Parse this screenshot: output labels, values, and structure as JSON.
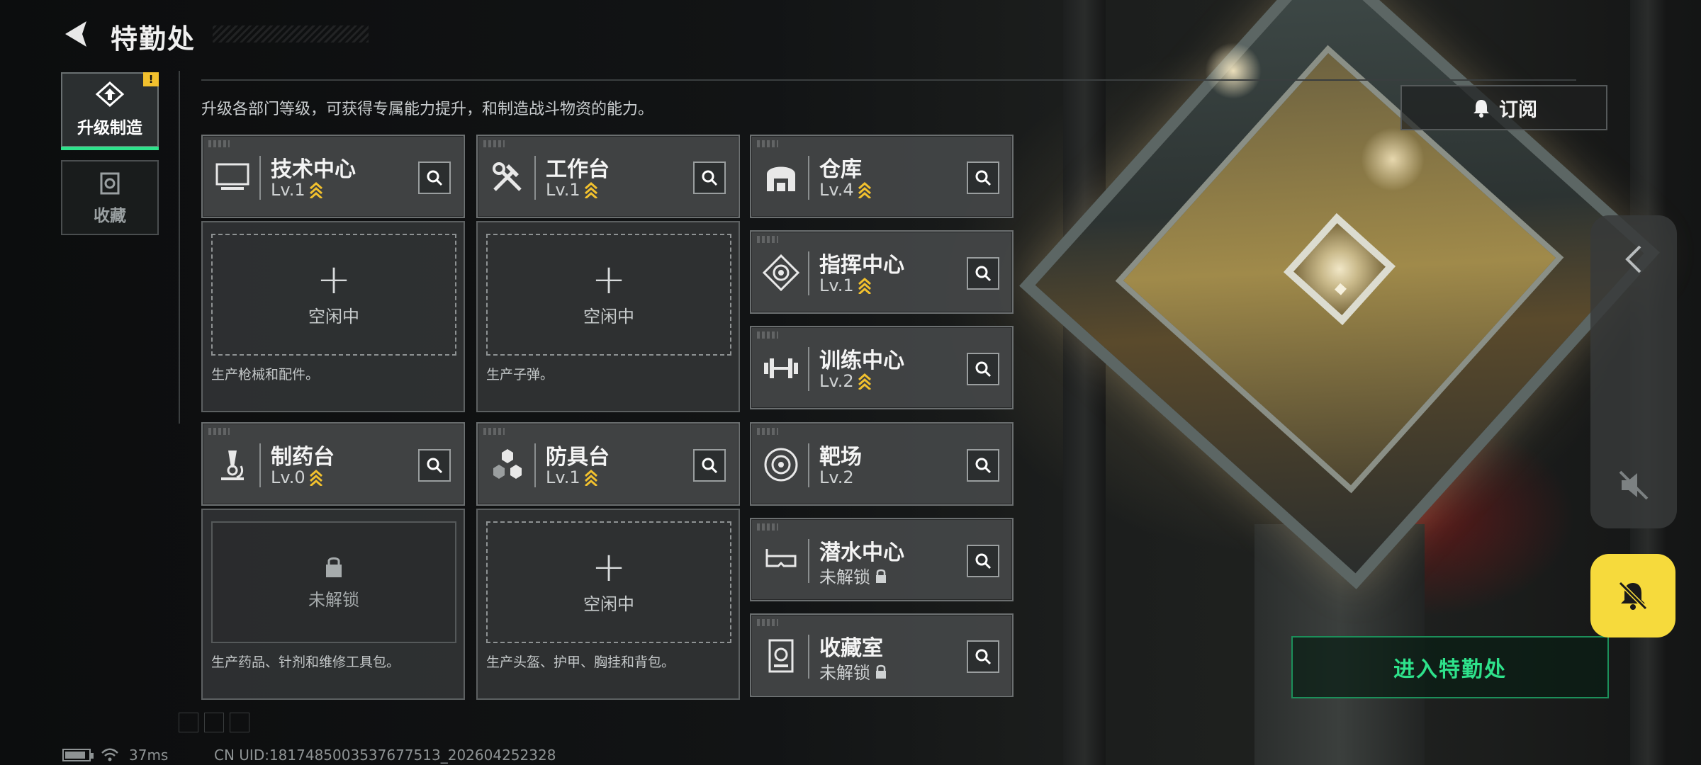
{
  "header": {
    "title": "特勤处"
  },
  "tabs": [
    {
      "label": "升级制造",
      "alert": "!",
      "icon": "upgrade-icon"
    },
    {
      "label": "收藏",
      "icon": "collection-icon"
    }
  ],
  "description": "升级各部门等级，可获得专属能力提升，和制造战斗物资的能力。",
  "subscribe_label": "订阅",
  "columns": {
    "left": {
      "top_card": {
        "name": "技术中心",
        "level": "Lv.1",
        "icon": "computer-icon"
      },
      "top_panel": {
        "slot_text": "空闲中",
        "desc": "生产枪械和配件。"
      },
      "bottom_card": {
        "name": "制药台",
        "level": "Lv.0",
        "icon": "microscope-icon"
      },
      "bottom_panel": {
        "slot_text": "未解锁",
        "desc": "生产药品、针剂和维修工具包。"
      }
    },
    "middle": {
      "top_card": {
        "name": "工作台",
        "level": "Lv.1",
        "icon": "tools-icon"
      },
      "top_panel": {
        "slot_text": "空闲中",
        "desc": "生产子弹。"
      },
      "bottom_card": {
        "name": "防具台",
        "level": "Lv.1",
        "icon": "armor-hex-icon"
      },
      "bottom_panel": {
        "slot_text": "空闲中",
        "desc": "生产头盔、护甲、胸挂和背包。"
      }
    },
    "right": [
      {
        "name": "仓库",
        "level": "Lv.4",
        "icon": "warehouse-icon"
      },
      {
        "name": "指挥中心",
        "level": "Lv.1",
        "icon": "command-icon"
      },
      {
        "name": "训练中心",
        "level": "Lv.2",
        "icon": "dumbbell-icon"
      },
      {
        "name": "靶场",
        "level": "Lv.2",
        "icon": "target-icon"
      },
      {
        "name": "潜水中心",
        "level": "未解锁",
        "icon": "diving-mask-icon"
      },
      {
        "name": "收藏室",
        "level": "未解锁",
        "icon": "collection-room-icon"
      }
    ]
  },
  "enter_button": "进入特勤处",
  "status": {
    "ping": "37ms",
    "uid": "CN UID:1817485003537677513_202604252328"
  },
  "colors": {
    "accent_green": "#2ee28b",
    "upgrade_gold": "#f2c12e",
    "bell_yellow": "#f6da3c"
  }
}
